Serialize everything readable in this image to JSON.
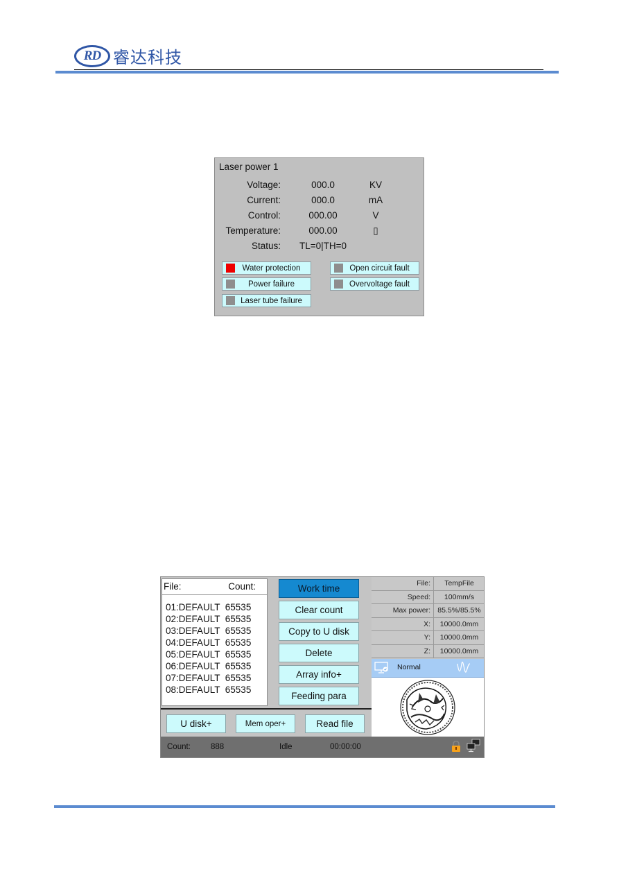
{
  "header": {
    "logo_mark": "RD",
    "logo_text": "睿达科技"
  },
  "laser_power_panel": {
    "title": "Laser power 1",
    "rows": [
      {
        "label": "Voltage:",
        "value": "000.0",
        "unit": "KV"
      },
      {
        "label": "Current:",
        "value": "000.0",
        "unit": "mA"
      },
      {
        "label": "Control:",
        "value": "000.00",
        "unit": "V"
      },
      {
        "label": "Temperature:",
        "value": "000.00",
        "unit": "▯"
      },
      {
        "label": "Status:",
        "value": "TL=0|TH=0",
        "unit": ""
      }
    ],
    "faults": [
      {
        "label": "Water protection",
        "active": true
      },
      {
        "label": "Open circuit fault",
        "active": false
      },
      {
        "label": "Power failure",
        "active": false
      },
      {
        "label": "Overvoltage fault",
        "active": false
      },
      {
        "label": "Laser tube failure",
        "active": false
      }
    ],
    "colors": {
      "indicator_on": "#ee0000",
      "indicator_off": "#8e8e8e",
      "fault_bg": "#ccfafc"
    }
  },
  "main_ui": {
    "file_list": {
      "header_file": "File:",
      "header_count": "Count:",
      "items": [
        "01:DEFAULT  65535",
        "02:DEFAULT  65535",
        "03:DEFAULT  65535",
        "04:DEFAULT  65535",
        "05:DEFAULT  65535",
        "06:DEFAULT  65535",
        "07:DEFAULT  65535",
        "08:DEFAULT  65535"
      ]
    },
    "side_buttons": [
      "Work time",
      "Clear count",
      "Copy to U disk",
      "Delete",
      "Array info+",
      "Feeding para"
    ],
    "bottom_buttons": [
      "U disk+",
      "Mem oper+",
      "Read file"
    ],
    "info": [
      {
        "key": "File:",
        "value": "TempFile"
      },
      {
        "key": "Speed:",
        "value": "100mm/s"
      },
      {
        "key": "Max power:",
        "value": "85.5%/85.5%"
      },
      {
        "key": "X:",
        "value": "10000.0mm"
      },
      {
        "key": "Y:",
        "value": "10000.0mm"
      },
      {
        "key": "Z:",
        "value": "10000.0mm"
      }
    ],
    "mode": "Normal",
    "status_bar": {
      "count_label": "Count:",
      "count_value": "888",
      "state": "Idle",
      "time": "00:00:00"
    },
    "colors": {
      "active_button": "#1589d0",
      "button_bg": "#ccfafc",
      "mode_bar": "#a6ccf5",
      "status_bar": "#6f6f6f"
    }
  }
}
